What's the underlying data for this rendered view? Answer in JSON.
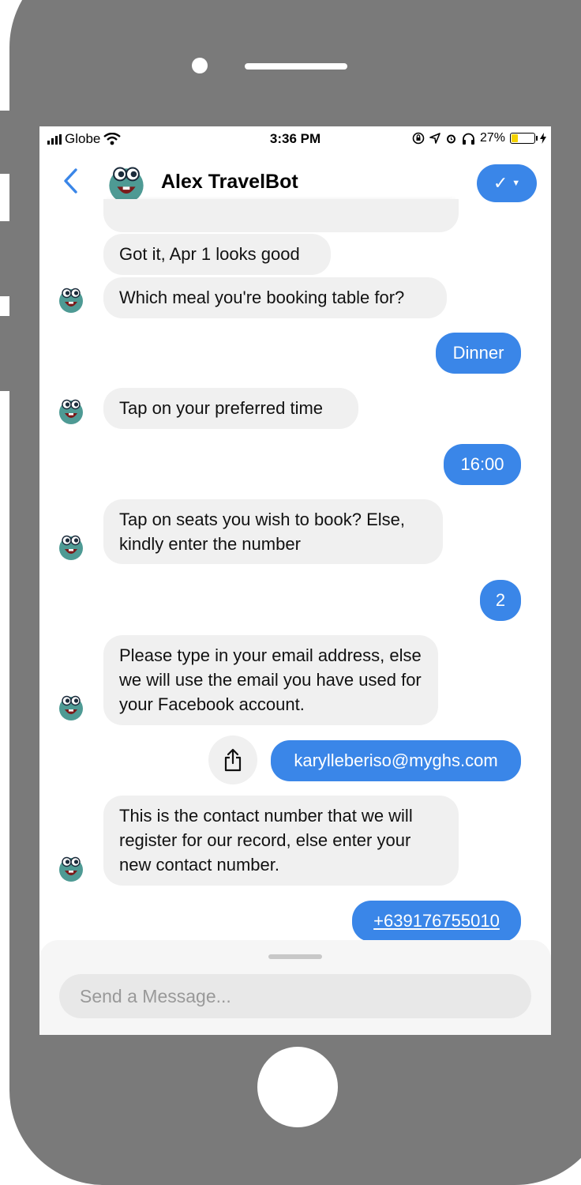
{
  "status_bar": {
    "carrier": "Globe",
    "time": "3:36 PM",
    "battery_percent": "27%",
    "battery_level": 0.27
  },
  "header": {
    "title": "Alex TravelBot",
    "accent_color": "#3a86e8"
  },
  "messages": [
    {
      "from": "bot",
      "text": "Got it, Apr 1 looks good"
    },
    {
      "from": "bot",
      "text": "Which meal you're booking table for?"
    },
    {
      "from": "user",
      "text": "Dinner"
    },
    {
      "from": "bot",
      "text": "Tap on your preferred time"
    },
    {
      "from": "user",
      "text": "16:00"
    },
    {
      "from": "bot",
      "text": "Tap on seats you wish to book? Else, kindly enter the number"
    },
    {
      "from": "user",
      "text": "2"
    },
    {
      "from": "bot",
      "text": "Please type in your email address, else we will use the email you have used for your Facebook account."
    },
    {
      "from": "user",
      "text": "karylleberiso@myghs.com"
    },
    {
      "from": "bot",
      "text": "This is the contact number that we will register for our record, else enter your new contact number."
    },
    {
      "from": "user",
      "text": "+639176755010"
    }
  ],
  "composer": {
    "placeholder": "Send a Message..."
  }
}
